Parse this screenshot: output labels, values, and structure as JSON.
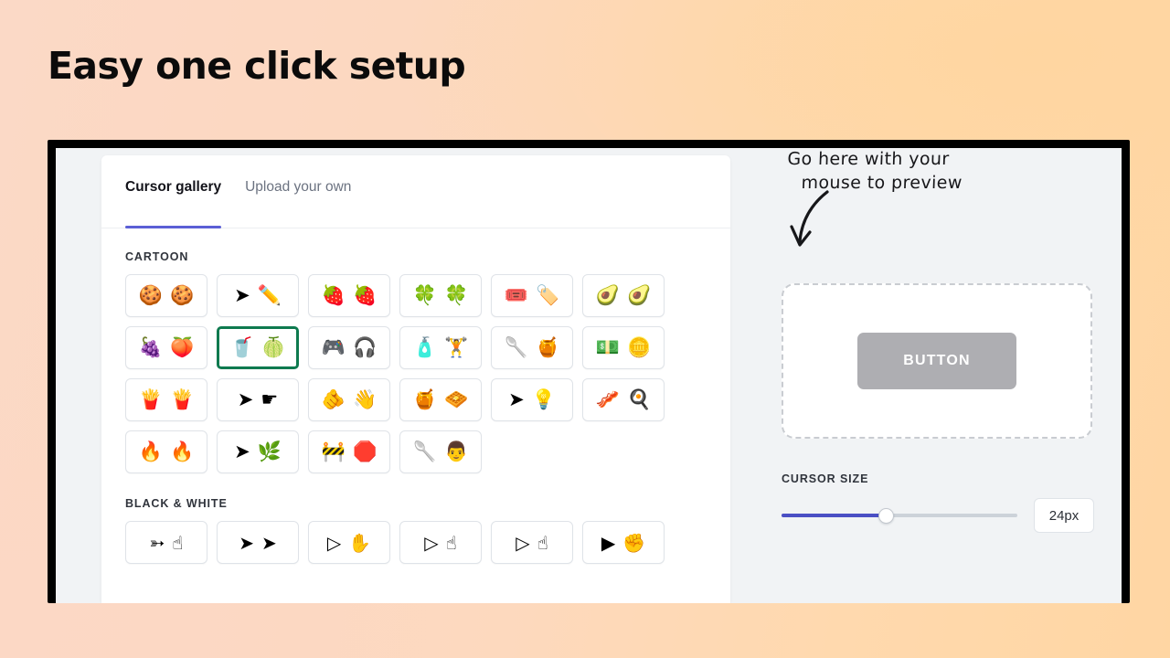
{
  "headline": "Easy one click setup",
  "colors": {
    "accent": "#5b5fd6",
    "slider_fill": "#4a4fc4",
    "selected_border": "#0e7a4f",
    "button_bg": "#aeaeb2",
    "bg_start": "#fbd9c6",
    "bg_end": "#ffd6a3"
  },
  "tabs": [
    {
      "label": "Cursor gallery",
      "active": true
    },
    {
      "label": "Upload your own",
      "active": false
    }
  ],
  "sections": [
    {
      "title": "CARTOON",
      "tiles": [
        {
          "name": "cookie-cursor",
          "glyphs": [
            "🍪",
            "🍪"
          ],
          "selected": false
        },
        {
          "name": "pencil-cursor",
          "glyphs": [
            "➤",
            "✏️"
          ],
          "selected": false
        },
        {
          "name": "strawberry-cursor",
          "glyphs": [
            "🍓",
            "🍓"
          ],
          "selected": false
        },
        {
          "name": "clover-cursor",
          "glyphs": [
            "🍀",
            "🍀"
          ],
          "selected": false
        },
        {
          "name": "ticket-cursor",
          "glyphs": [
            "🎟️",
            "🏷️"
          ],
          "selected": false
        },
        {
          "name": "avocado-cursor",
          "glyphs": [
            "🥑",
            "🥑"
          ],
          "selected": false
        },
        {
          "name": "plum-cursor",
          "glyphs": [
            "🍇",
            "🍑"
          ],
          "selected": false
        },
        {
          "name": "soda-lime-cursor",
          "glyphs": [
            "🥤",
            "🍈"
          ],
          "selected": true
        },
        {
          "name": "gaming-cursor",
          "glyphs": [
            "🎮",
            "🎧"
          ],
          "selected": false
        },
        {
          "name": "fitness-cursor",
          "glyphs": [
            "🧴",
            "🏋️"
          ],
          "selected": false
        },
        {
          "name": "honey-cursor",
          "glyphs": [
            "🥄",
            "🍯"
          ],
          "selected": false
        },
        {
          "name": "money-cursor",
          "glyphs": [
            "💵",
            "🪙"
          ],
          "selected": false
        },
        {
          "name": "fries-cursor",
          "glyphs": [
            "🍟",
            "🍟"
          ],
          "selected": false
        },
        {
          "name": "classic-toon-cursor",
          "glyphs": [
            "➤",
            "☛"
          ],
          "selected": false
        },
        {
          "name": "glove-hand-cursor",
          "glyphs": [
            "🫵",
            "👋"
          ],
          "selected": false
        },
        {
          "name": "waffle-cursor",
          "glyphs": [
            "🍯",
            "🧇"
          ],
          "selected": false
        },
        {
          "name": "lightbulb-cursor",
          "glyphs": [
            "➤",
            "💡"
          ],
          "selected": false
        },
        {
          "name": "breakfast-cursor",
          "glyphs": [
            "🥓",
            "🍳"
          ],
          "selected": false
        },
        {
          "name": "flame-cursor",
          "glyphs": [
            "🔥",
            "🔥"
          ],
          "selected": false
        },
        {
          "name": "green-arrow-cursor",
          "glyphs": [
            "➤",
            "🌿"
          ],
          "selected": false
        },
        {
          "name": "traffic-stop-cursor",
          "glyphs": [
            "🚧",
            "🛑"
          ],
          "selected": false
        },
        {
          "name": "spatula-cursor",
          "glyphs": [
            "🥄",
            "👨"
          ],
          "selected": false
        }
      ]
    },
    {
      "title": "BLACK & WHITE",
      "tiles": [
        {
          "name": "classic-outline-cursor",
          "glyphs": [
            "➳",
            "☝"
          ],
          "selected": false,
          "mono": true
        },
        {
          "name": "periwinkle-cursor",
          "glyphs": [
            "➤",
            "➤"
          ],
          "selected": false,
          "mono": true
        },
        {
          "name": "thin-arrow-cursor",
          "glyphs": [
            "▷",
            "✋"
          ],
          "selected": false,
          "mono": true
        },
        {
          "name": "rounded-arrow-cursor",
          "glyphs": [
            "▷",
            "☝"
          ],
          "selected": false,
          "mono": true
        },
        {
          "name": "sharp-arrow-cursor",
          "glyphs": [
            "▷",
            "☝"
          ],
          "selected": false,
          "mono": true
        },
        {
          "name": "solid-arrow-cursor",
          "glyphs": [
            "▶",
            "✊"
          ],
          "selected": false,
          "mono": true
        }
      ]
    }
  ],
  "preview": {
    "annotation_line1": "Go here with your",
    "annotation_line2": "mouse to preview",
    "button_label": "BUTTON"
  },
  "cursor_size": {
    "label": "CURSOR SIZE",
    "value": "24px",
    "percent": 44
  }
}
